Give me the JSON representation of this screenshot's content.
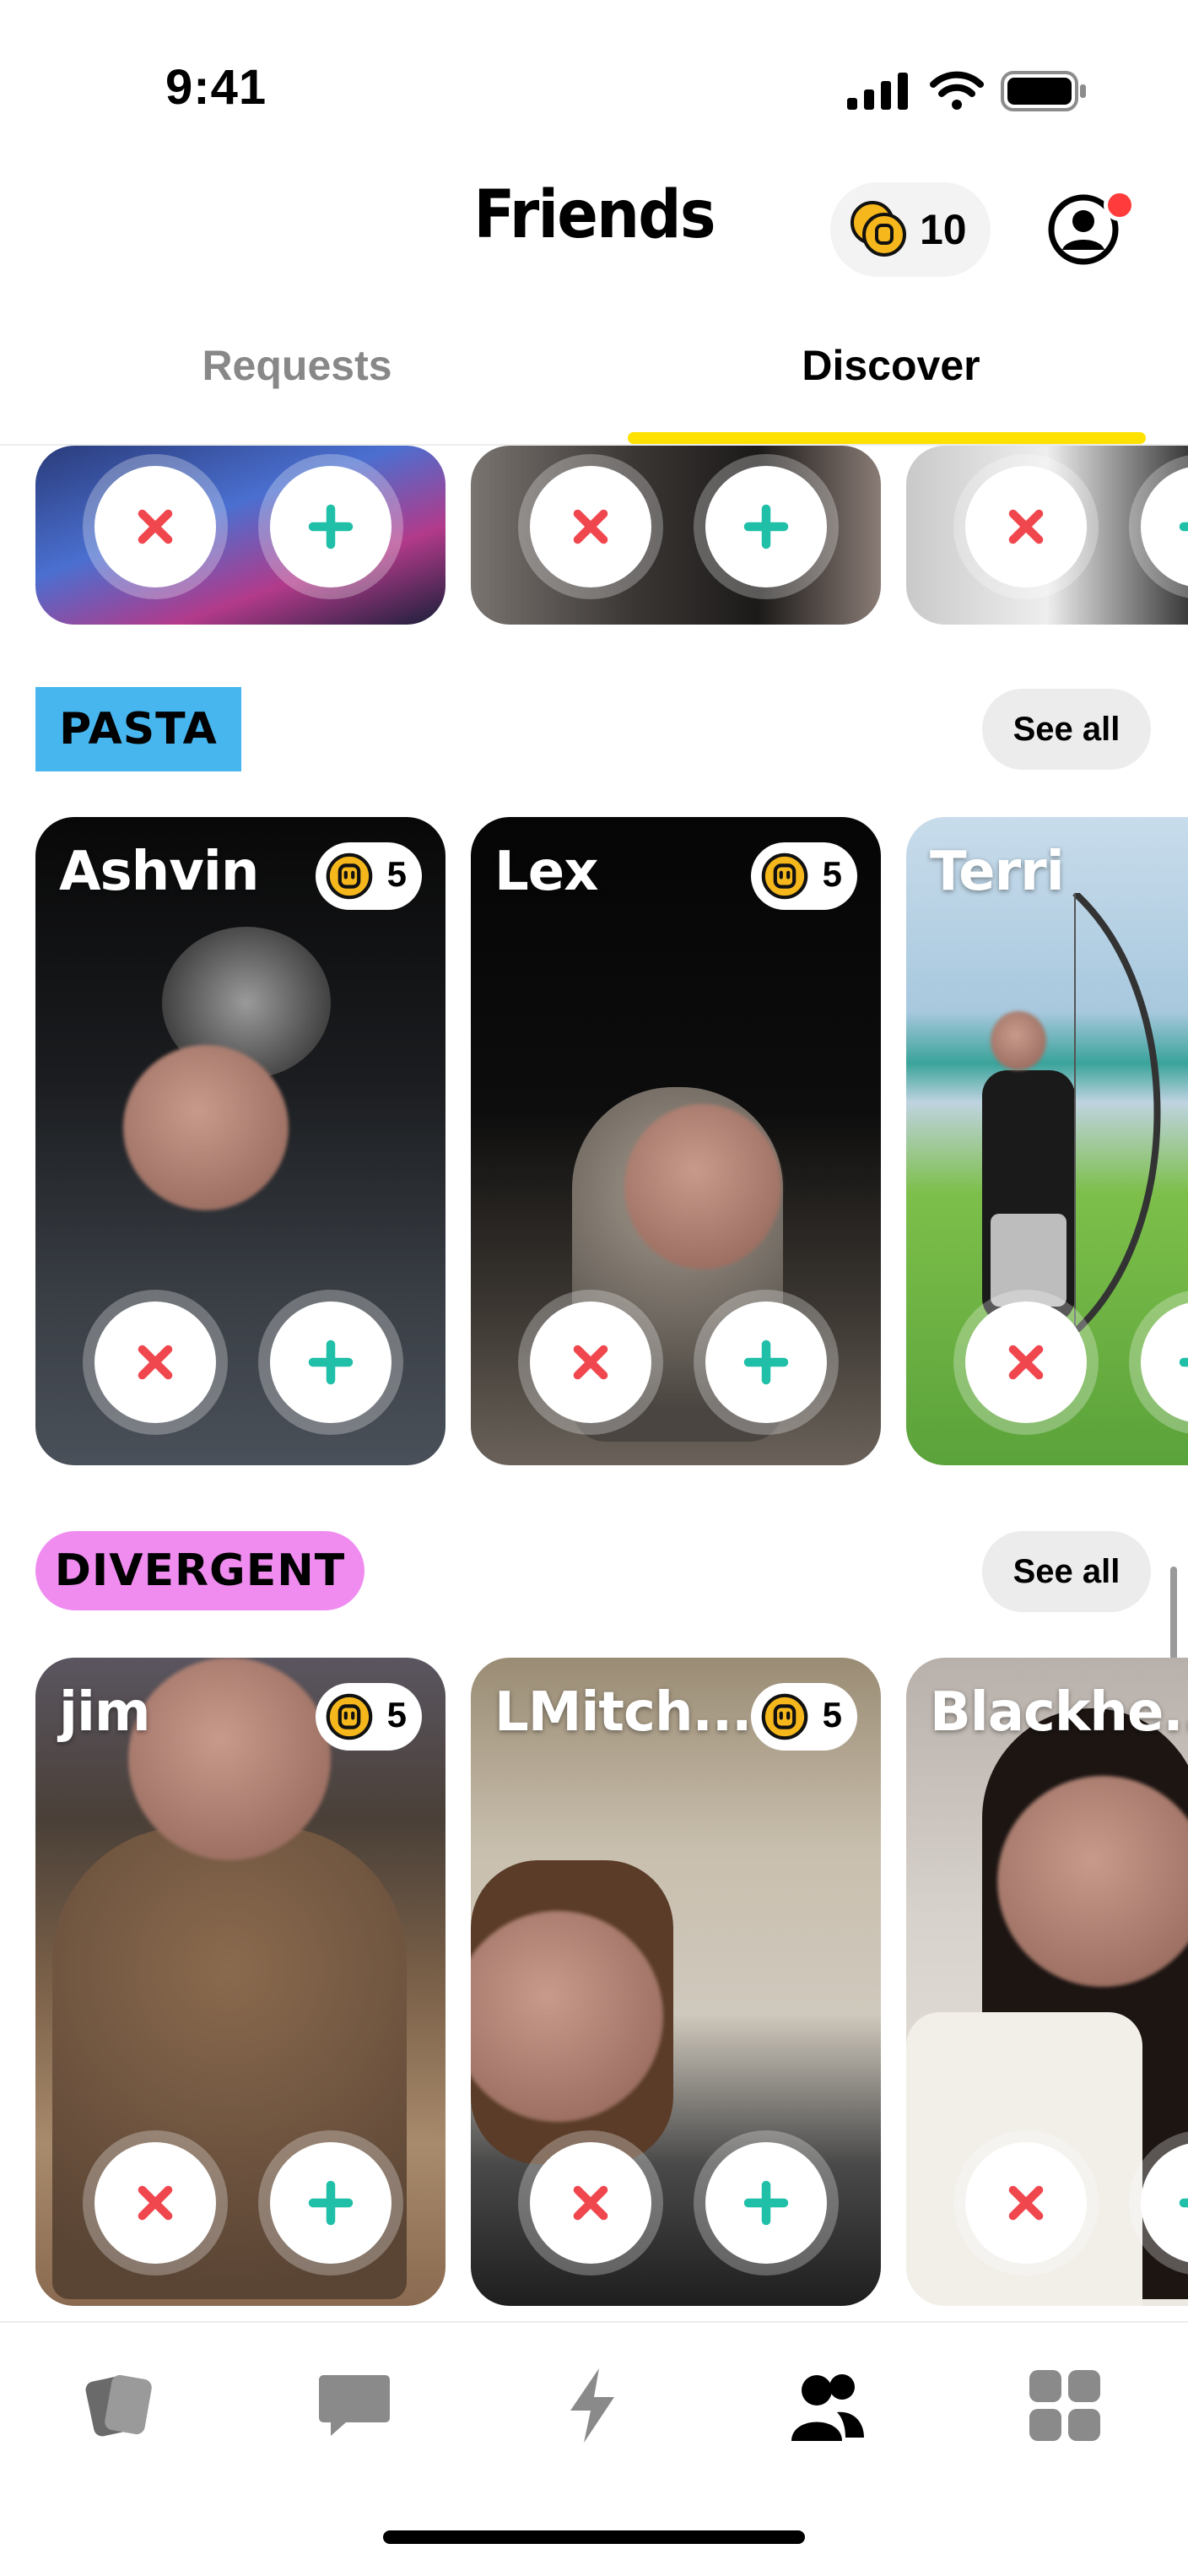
{
  "status_bar": {
    "time": "9:41"
  },
  "header": {
    "title": "Friends",
    "coin_balance": "10"
  },
  "tabs": [
    {
      "label": "Requests",
      "active": false
    },
    {
      "label": "Discover",
      "active": true
    }
  ],
  "sections": [
    {
      "label": "PASTA",
      "label_color": "#47b6ef",
      "see_all": "See all",
      "cards": [
        {
          "name": "Ashvin",
          "coins": "5"
        },
        {
          "name": "Lex",
          "coins": "5"
        },
        {
          "name": "Terri"
        }
      ]
    },
    {
      "label": "DIVERGENT",
      "label_color": "#f08cf0",
      "see_all": "See all",
      "cards": [
        {
          "name": "jim",
          "coins": "5"
        },
        {
          "name": "LMitch...",
          "coins": "5"
        },
        {
          "name": "Blackhe..."
        }
      ]
    }
  ],
  "bottom_nav": [
    {
      "icon": "cards-icon",
      "active": false
    },
    {
      "icon": "chat-icon",
      "active": false
    },
    {
      "icon": "bolt-icon",
      "active": false
    },
    {
      "icon": "friends-icon",
      "active": true
    },
    {
      "icon": "grid-icon",
      "active": false
    }
  ],
  "colors": {
    "accent_yellow": "#ffe100",
    "decline_red": "#f0474f",
    "accept_teal": "#1fbfa8",
    "coin_gold": "#f5b71c"
  }
}
